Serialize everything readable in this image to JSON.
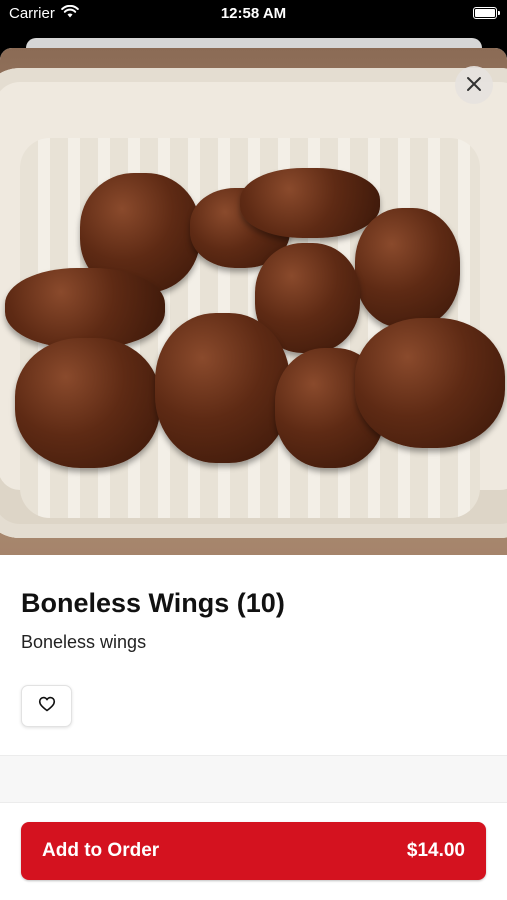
{
  "status_bar": {
    "carrier": "Carrier",
    "time": "12:58 AM"
  },
  "item": {
    "title": "Boneless Wings (10)",
    "description": "Boneless wings",
    "image_alt": "boneless wings in takeout container"
  },
  "actions": {
    "close_icon": "close-icon",
    "favorite_icon": "heart-outline-icon"
  },
  "order_button": {
    "label": "Add to Order",
    "price": "$14.00"
  },
  "colors": {
    "accent": "#d4121f"
  }
}
